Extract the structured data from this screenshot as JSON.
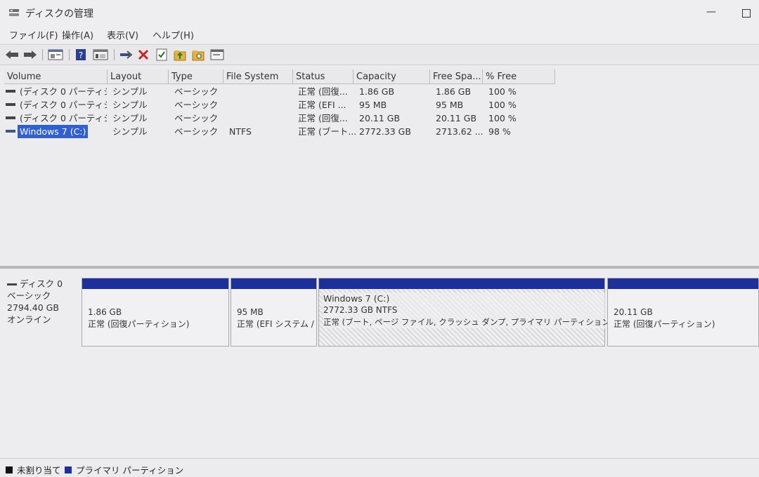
{
  "window": {
    "title": "ディスクの管理",
    "minimize_label": "—"
  },
  "menu": [
    "ファイル(F)",
    "操作(A)",
    "表示(V)",
    "ヘルプ(H)"
  ],
  "toolbar": {
    "icons": [
      "back-arrow-icon",
      "forward-arrow-icon",
      "console-tree-icon",
      "help-icon",
      "properties-icon",
      "connect-icon",
      "delete-icon",
      "check-icon",
      "folder-up-icon",
      "folder-search-icon",
      "window-icon"
    ]
  },
  "volume_list": {
    "columns": [
      "Volume",
      "Layout",
      "Type",
      "File System",
      "Status",
      "Capacity",
      "Free Spa...",
      "% Free"
    ],
    "rows": [
      {
        "volume": "(ディスク 0 パーティシ...",
        "layout": "シンプル",
        "type": "ベーシック",
        "fs": "",
        "status": "正常 (回復...",
        "capacity": "1.86 GB",
        "free": "1.86 GB",
        "pct": "100 %",
        "selected": false
      },
      {
        "volume": "(ディスク 0 パーティシ...",
        "layout": "シンプル",
        "type": "ベーシック",
        "fs": "",
        "status": "正常 (EFI ...",
        "capacity": "95 MB",
        "free": "95 MB",
        "pct": "100 %",
        "selected": false
      },
      {
        "volume": "(ディスク 0 パーティシ...",
        "layout": "シンプル",
        "type": "ベーシック",
        "fs": "",
        "status": "正常 (回復...",
        "capacity": "20.11 GB",
        "free": "20.11 GB",
        "pct": "100 %",
        "selected": false
      },
      {
        "volume": "Windows 7 (C:)",
        "layout": "シンプル",
        "type": "ベーシック",
        "fs": "NTFS",
        "status": "正常 (ブート...",
        "capacity": "2772.33 GB",
        "free": "2713.62 ...",
        "pct": "98 %",
        "selected": true
      }
    ]
  },
  "disk": {
    "name": "ディスク 0",
    "type": "ベーシック",
    "size": "2794.40 GB",
    "state": "オンライン",
    "partitions": [
      {
        "name": "",
        "size": "1.86 GB",
        "status": "正常 (回復パーティション)"
      },
      {
        "name": "",
        "size": "95 MB",
        "status": "正常 (EFI システム /"
      },
      {
        "name": "Windows 7 (C:)",
        "size": "2772.33 GB NTFS",
        "status": "正常 (ブート, ページ ファイル, クラッシュ ダンプ, プライマリ パーティション)"
      },
      {
        "name": "",
        "size": "20.11 GB",
        "status": "正常 (回復パーティション)"
      }
    ]
  },
  "legend": [
    {
      "label": "未割り当て",
      "color": "#111111"
    },
    {
      "label": "プライマリ パーティション",
      "color": "#1d2f9a"
    }
  ],
  "colors": {
    "partition_bar": "#1d2f9a",
    "selection": "#2f5fd0"
  }
}
